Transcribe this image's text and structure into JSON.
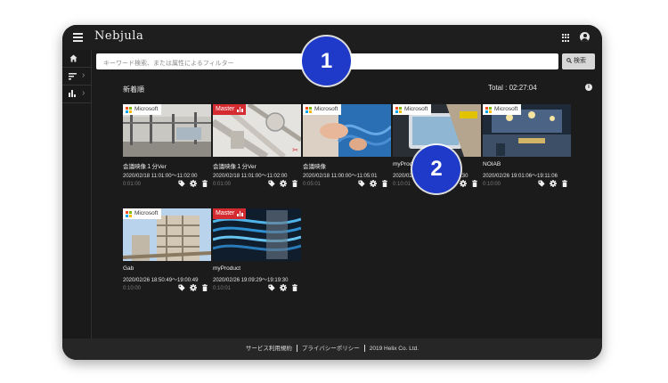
{
  "app": {
    "logo": "Nebjula"
  },
  "header": {
    "menu_icon": "hamburger-menu-icon",
    "apps_icon": "grid-apps-icon",
    "account_icon": "account-circle-icon"
  },
  "sidebar": {
    "items": [
      {
        "icon": "home-icon"
      },
      {
        "icon": "sort-icon"
      },
      {
        "icon": "bar-chart-icon"
      }
    ]
  },
  "search": {
    "placeholder": "キーワード検索、または属性によるフィルター",
    "button_label": "検索",
    "button_icon": "search-icon"
  },
  "list": {
    "sort_label": "新着順",
    "total_label": "Total : 02:27:04"
  },
  "cards": [
    {
      "badge_type": "microsoft",
      "badge_label": "Microsoft",
      "title": "会議映像１分Ver",
      "datetime": "2020/02/18 11:01:00〜11:02:00",
      "duration": "0:01:00",
      "scene": "construction"
    },
    {
      "badge_type": "master",
      "badge_label": "Master",
      "title": "会議映像１分Ver",
      "datetime": "2020/02/18 11:01:00〜11:02:00",
      "duration": "0:01:00",
      "scene": "pipes"
    },
    {
      "badge_type": "microsoft",
      "badge_label": "Microsoft",
      "title": "会議映像",
      "datetime": "2020/02/18 11:00:00〜11:05:01",
      "duration": "0:05:01",
      "scene": "cables"
    },
    {
      "badge_type": "microsoft",
      "badge_label": "Microsoft",
      "title": "myProduct",
      "datetime": "2020/02/26 19:09:29〜19:19:30",
      "duration": "0:10:01",
      "scene": "tablet"
    },
    {
      "badge_type": "microsoft",
      "badge_label": "Microsoft",
      "title": "NOIAB",
      "datetime": "2020/02/26 19:01:06〜19:11:06",
      "duration": "0:10:00",
      "scene": "hall"
    },
    {
      "badge_type": "microsoft",
      "badge_label": "Microsoft",
      "title": "Gab",
      "datetime": "2020/02/26 18:50:49〜19:00:49",
      "duration": "0:10:00",
      "scene": "building"
    },
    {
      "badge_type": "master",
      "badge_label": "Master",
      "title": "myProduct",
      "datetime": "2020/02/26 19:09:29〜19:19:30",
      "duration": "0:10:01",
      "scene": "network"
    }
  ],
  "footer": {
    "links": [
      "サービス利用規約",
      "プライバシーポリシー"
    ],
    "copyright": "2019 Helix Co. Ltd."
  },
  "callouts": [
    "1",
    "2"
  ],
  "colors": {
    "background": "#1b1b1b",
    "master_badge": "#d42b30",
    "callout": "#1f3ac8"
  }
}
